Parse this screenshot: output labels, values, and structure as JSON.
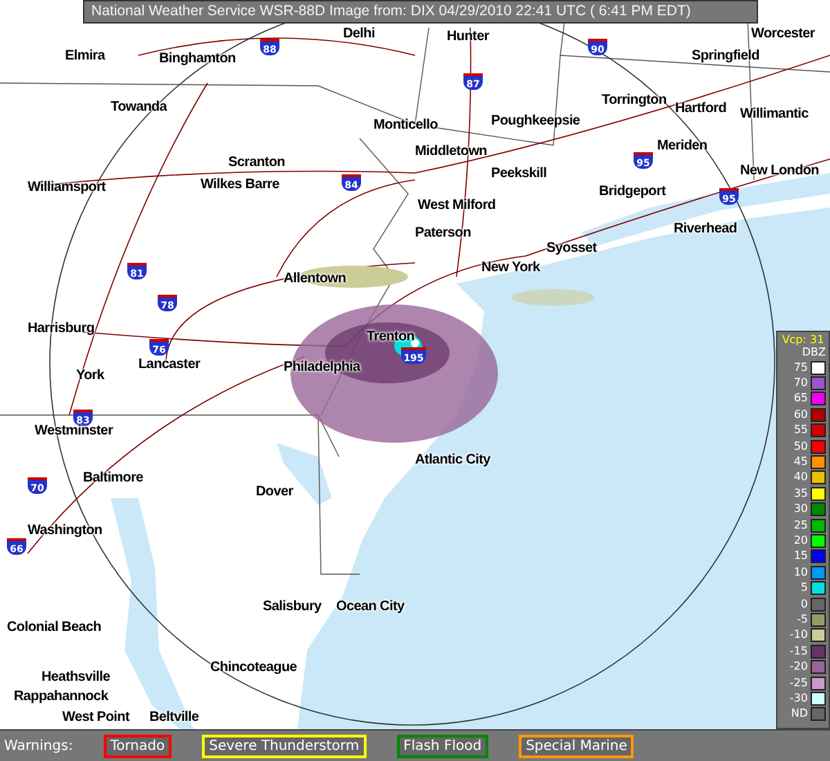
{
  "title": "National Weather Service WSR-88D Image from: DIX 04/29/2010 22:41 UTC ( 6:41 PM EDT)",
  "cities": [
    {
      "name": "Delhi"
    },
    {
      "name": "Hunter"
    },
    {
      "name": "Worcester"
    },
    {
      "name": "Elmira"
    },
    {
      "name": "Binghamton"
    },
    {
      "name": "Springfield"
    },
    {
      "name": "Towanda"
    },
    {
      "name": "Torrington"
    },
    {
      "name": "Hartford"
    },
    {
      "name": "Willimantic"
    },
    {
      "name": "Monticello"
    },
    {
      "name": "Poughkeepsie"
    },
    {
      "name": "Middletown"
    },
    {
      "name": "Meriden"
    },
    {
      "name": "Scranton"
    },
    {
      "name": "Peekskill"
    },
    {
      "name": "New London"
    },
    {
      "name": "Williamsport"
    },
    {
      "name": "Wilkes Barre"
    },
    {
      "name": "Bridgeport"
    },
    {
      "name": "West Milford"
    },
    {
      "name": "Paterson"
    },
    {
      "name": "Riverhead"
    },
    {
      "name": "Syosset"
    },
    {
      "name": "New York"
    },
    {
      "name": "Allentown"
    },
    {
      "name": "Harrisburg"
    },
    {
      "name": "Trenton"
    },
    {
      "name": "York"
    },
    {
      "name": "Lancaster"
    },
    {
      "name": "Philadelphia"
    },
    {
      "name": "Westminster"
    },
    {
      "name": "Atlantic City"
    },
    {
      "name": "Baltimore"
    },
    {
      "name": "Dover"
    },
    {
      "name": "Washington"
    },
    {
      "name": "Salisbury"
    },
    {
      "name": "Ocean City"
    },
    {
      "name": "Colonial Beach"
    },
    {
      "name": "Heathsville"
    },
    {
      "name": "Chincoteague"
    },
    {
      "name": "Rappahannock"
    },
    {
      "name": "West Point"
    },
    {
      "name": "Beltville"
    }
  ],
  "highways": [
    {
      "number": "88"
    },
    {
      "number": "87"
    },
    {
      "number": "90"
    },
    {
      "number": "95"
    },
    {
      "number": "84"
    },
    {
      "number": "95"
    },
    {
      "number": "81"
    },
    {
      "number": "78"
    },
    {
      "number": "76"
    },
    {
      "number": "195"
    },
    {
      "number": "83"
    },
    {
      "number": "70"
    },
    {
      "number": "66"
    }
  ],
  "legend": {
    "vcp": "Vcp: 31",
    "unit": "DBZ",
    "levels": [
      {
        "label": "75",
        "color": "#ffffff"
      },
      {
        "label": "70",
        "color": "#9955c9"
      },
      {
        "label": "65",
        "color": "#f000f0"
      },
      {
        "label": "60",
        "color": "#b00000"
      },
      {
        "label": "55",
        "color": "#d00000"
      },
      {
        "label": "50",
        "color": "#ff0000"
      },
      {
        "label": "45",
        "color": "#ff9000"
      },
      {
        "label": "40",
        "color": "#e7c000"
      },
      {
        "label": "35",
        "color": "#ffff00"
      },
      {
        "label": "30",
        "color": "#008800"
      },
      {
        "label": "25",
        "color": "#00bb00"
      },
      {
        "label": "20",
        "color": "#00ff00"
      },
      {
        "label": "15",
        "color": "#0000f0"
      },
      {
        "label": "10",
        "color": "#0099f0"
      },
      {
        "label": "5",
        "color": "#00e0e0"
      },
      {
        "label": "0",
        "color": "#666666"
      },
      {
        "label": "-5",
        "color": "#999966"
      },
      {
        "label": "-10",
        "color": "#cccc99"
      },
      {
        "label": "-15",
        "color": "#663366"
      },
      {
        "label": "-20",
        "color": "#996699"
      },
      {
        "label": "-25",
        "color": "#cc99cc"
      },
      {
        "label": "-30",
        "color": "#ccffff"
      },
      {
        "label": "ND",
        "color": "#666666"
      }
    ]
  },
  "warnings": {
    "label": "Warnings:",
    "items": [
      {
        "label": "Tornado",
        "color": "#ff0000"
      },
      {
        "label": "Severe Thunderstorm",
        "color": "#ffff00"
      },
      {
        "label": "Flash Flood",
        "color": "#008800"
      },
      {
        "label": "Special Marine",
        "color": "#ff9900"
      }
    ]
  }
}
